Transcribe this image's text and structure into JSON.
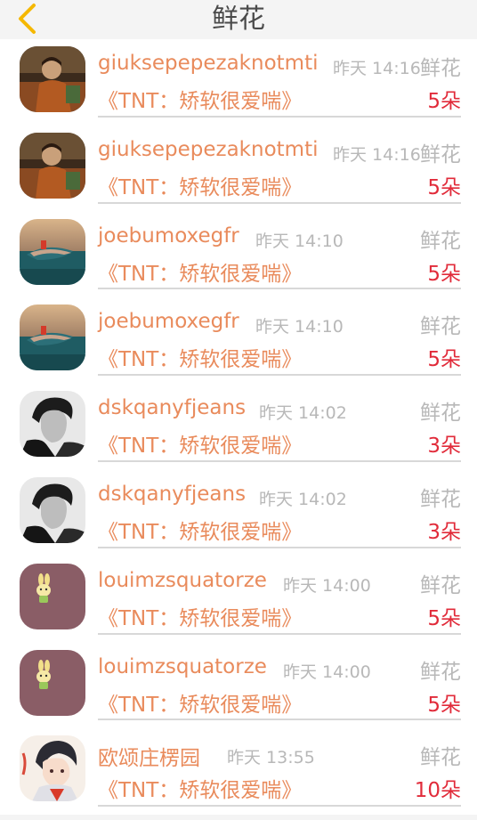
{
  "header": {
    "title": "鲜花"
  },
  "rows": [
    {
      "user": "giuksepepezaknotmti",
      "time": "昨天 14:16",
      "gift": "鲜花",
      "work": "《TNT：矫软很爱喘》",
      "count": "5朵",
      "avatar": "man-on-couch"
    },
    {
      "user": "giuksepepezaknotmti",
      "time": "昨天 14:16",
      "gift": "鲜花",
      "work": "《TNT：矫软很爱喘》",
      "count": "5朵",
      "avatar": "man-on-couch"
    },
    {
      "user": "joebumoxegfr",
      "time": "昨天 14:10",
      "gift": "鲜花",
      "work": "《TNT：矫软很爱喘》",
      "count": "5朵",
      "avatar": "fish-sea"
    },
    {
      "user": "joebumoxegfr",
      "time": "昨天 14:10",
      "gift": "鲜花",
      "work": "《TNT：矫软很爱喘》",
      "count": "5朵",
      "avatar": "fish-sea"
    },
    {
      "user": "dskqanyfjeans",
      "time": "昨天 14:02",
      "gift": "鲜花",
      "work": "《TNT：矫软很爱喘》",
      "count": "3朵",
      "avatar": "bw-portrait"
    },
    {
      "user": "dskqanyfjeans",
      "time": "昨天 14:02",
      "gift": "鲜花",
      "work": "《TNT：矫软很爱喘》",
      "count": "3朵",
      "avatar": "bw-portrait"
    },
    {
      "user": "louimzsquatorze",
      "time": "昨天 14:00",
      "gift": "鲜花",
      "work": "《TNT：矫软很爱喘》",
      "count": "5朵",
      "avatar": "bunny-purple"
    },
    {
      "user": "louimzsquatorze",
      "time": "昨天 14:00",
      "gift": "鲜花",
      "work": "《TNT：矫软很爱喘》",
      "count": "5朵",
      "avatar": "bunny-purple"
    },
    {
      "user": "欧颂庄楞园",
      "time": "昨天 13:55",
      "gift": "鲜花",
      "work": "《TNT：矫软很爱喘》",
      "count": "10朵",
      "avatar": "anime-boy"
    }
  ],
  "colors": {
    "accent": "#e98b5c",
    "count": "#e12b3a",
    "muted": "#b8b8b8",
    "back_arrow": "#f5b800"
  }
}
